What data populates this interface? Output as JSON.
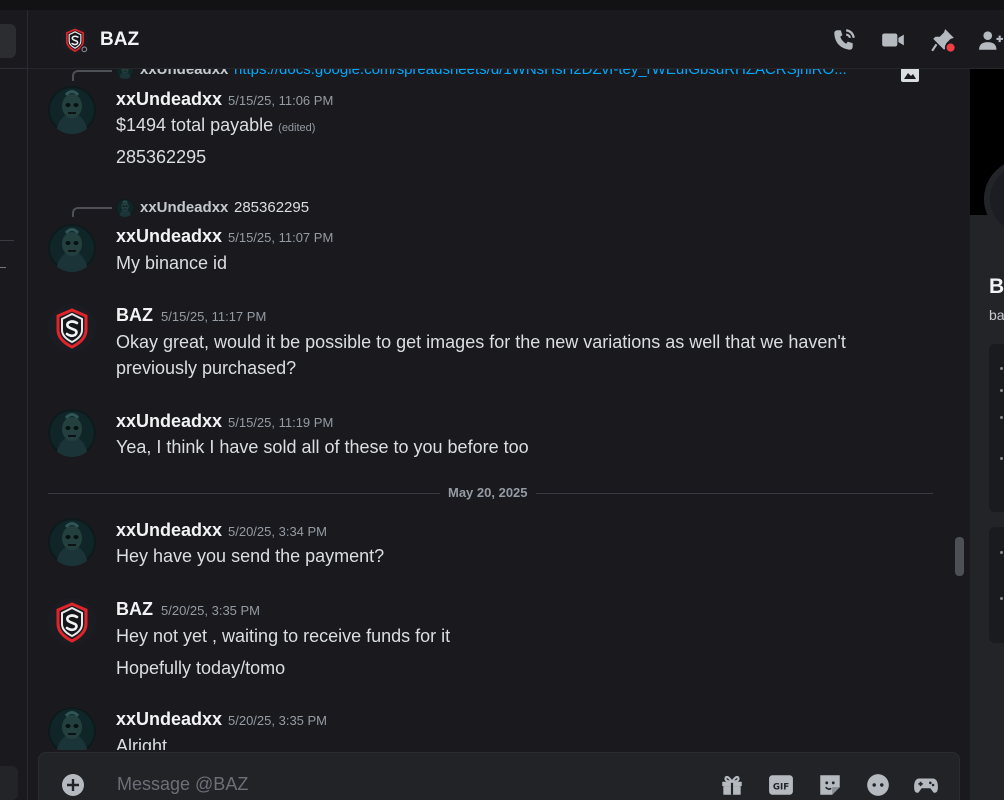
{
  "header": {
    "title": "BAZ"
  },
  "composer": {
    "placeholder": "Message @BAZ"
  },
  "date_divider": "May 20, 2025",
  "reply_preview_top": {
    "author": "xxUndeadxx",
    "link_text": "https://docs.google.com/spreadsheets/d/1WNsHsH2DZvI-tey_rWEuIGbsuRHZACRSjhlRO..."
  },
  "messages": [
    {
      "author": "xxUndeadxx",
      "time": "5/15/25, 11:06 PM",
      "lines": [
        "$1494 total payable",
        "285362295"
      ],
      "edited": "(edited)"
    },
    {
      "reply_author": "xxUndeadxx",
      "reply_text": "285362295",
      "author": "xxUndeadxx",
      "time": "5/15/25, 11:07 PM",
      "lines": [
        "My binance id"
      ]
    },
    {
      "author": "BAZ",
      "time": "5/15/25, 11:17 PM",
      "lines": [
        "Okay great, would it be possible to get images for the new variations as well that we haven't previously purchased?"
      ]
    },
    {
      "author": "xxUndeadxx",
      "time": "5/15/25, 11:19 PM",
      "lines": [
        "Yea, I think I have sold all of these to you before too"
      ]
    },
    {
      "author": "xxUndeadxx",
      "time": "5/20/25, 3:34 PM",
      "lines": [
        "Hey have you send the payment?"
      ]
    },
    {
      "author": "BAZ",
      "time": "5/20/25, 3:35 PM",
      "lines": [
        "Hey not yet , waiting to receive funds for it",
        "Hopefully today/tomo"
      ]
    },
    {
      "author": "xxUndeadxx",
      "time": "5/20/25, 3:35 PM",
      "lines": [
        "Alright"
      ]
    }
  ],
  "profile_panel": {
    "name": "B",
    "sub": "ba"
  },
  "icons": {
    "call": "phone-call-icon",
    "video": "video-camera-icon",
    "pin": "pin-icon",
    "add_member": "add-friend-icon",
    "gift": "gift-icon",
    "gif": "gif-icon",
    "sticker": "sticker-icon",
    "emoji": "emoji-icon",
    "apps": "gamepad-icon"
  },
  "colors": {
    "accent_red": "#e0242a",
    "link": "#00a8fc",
    "background": "#1a1a1e"
  }
}
